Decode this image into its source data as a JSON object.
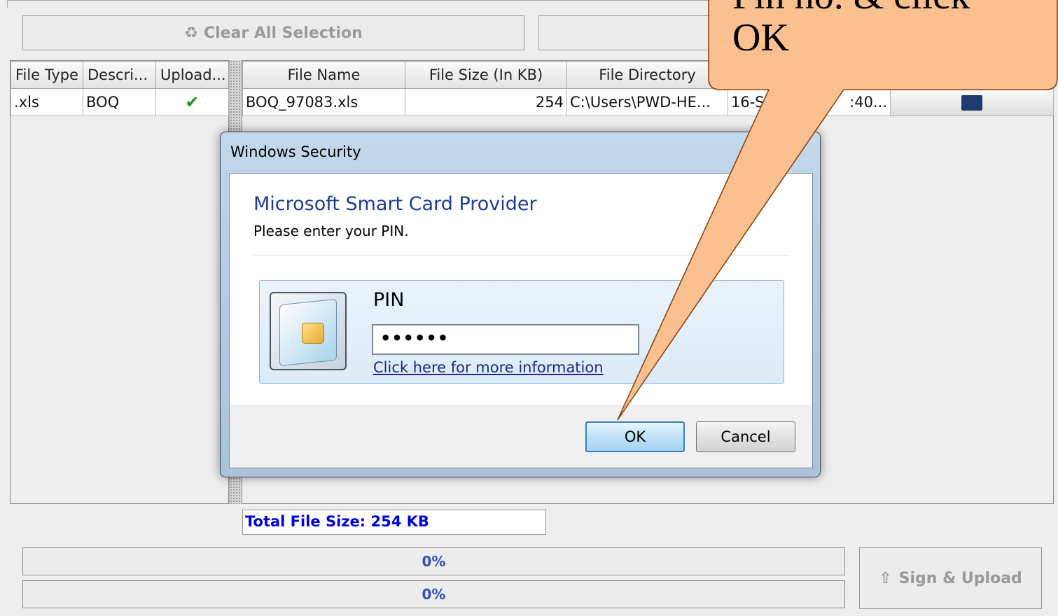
{
  "toolbar": {
    "clear_label": "Clear All Selection"
  },
  "left_table": {
    "headers": [
      "File Type",
      "Descri...",
      "Upload..."
    ],
    "row": {
      "type": ".xls",
      "description": "BOQ",
      "uploaded_icon": "check-icon"
    }
  },
  "right_table": {
    "headers": [
      "File Name",
      "File Size (In KB)",
      "File Directory"
    ],
    "row": {
      "name": "BOQ_97083.xls",
      "size": "254",
      "directory": "C:\\Users\\PWD-HE...",
      "date_partial": "16-S",
      "time_partial": ":40..."
    }
  },
  "total_size": "Total File Size: 254 KB",
  "progress": {
    "bar1": "0%",
    "bar2": "0%",
    "bar1_value": 0,
    "bar2_value": 0
  },
  "sign_button": "Sign & Upload",
  "dialog": {
    "title": "Windows Security",
    "heading": "Microsoft Smart Card Provider",
    "subtext": "Please enter your PIN.",
    "pin_label": "PIN",
    "pin_value": "••••••",
    "info_link": "Click here for more information",
    "ok_label": "OK",
    "cancel_label": "Cancel"
  },
  "callout": {
    "line1": "Pin no. & click",
    "line2": "OK"
  },
  "colors": {
    "callout_fill": "#fac090",
    "dialog_heading": "#1e3c96",
    "total_text": "#0000e0",
    "check": "#1a9a1a"
  }
}
